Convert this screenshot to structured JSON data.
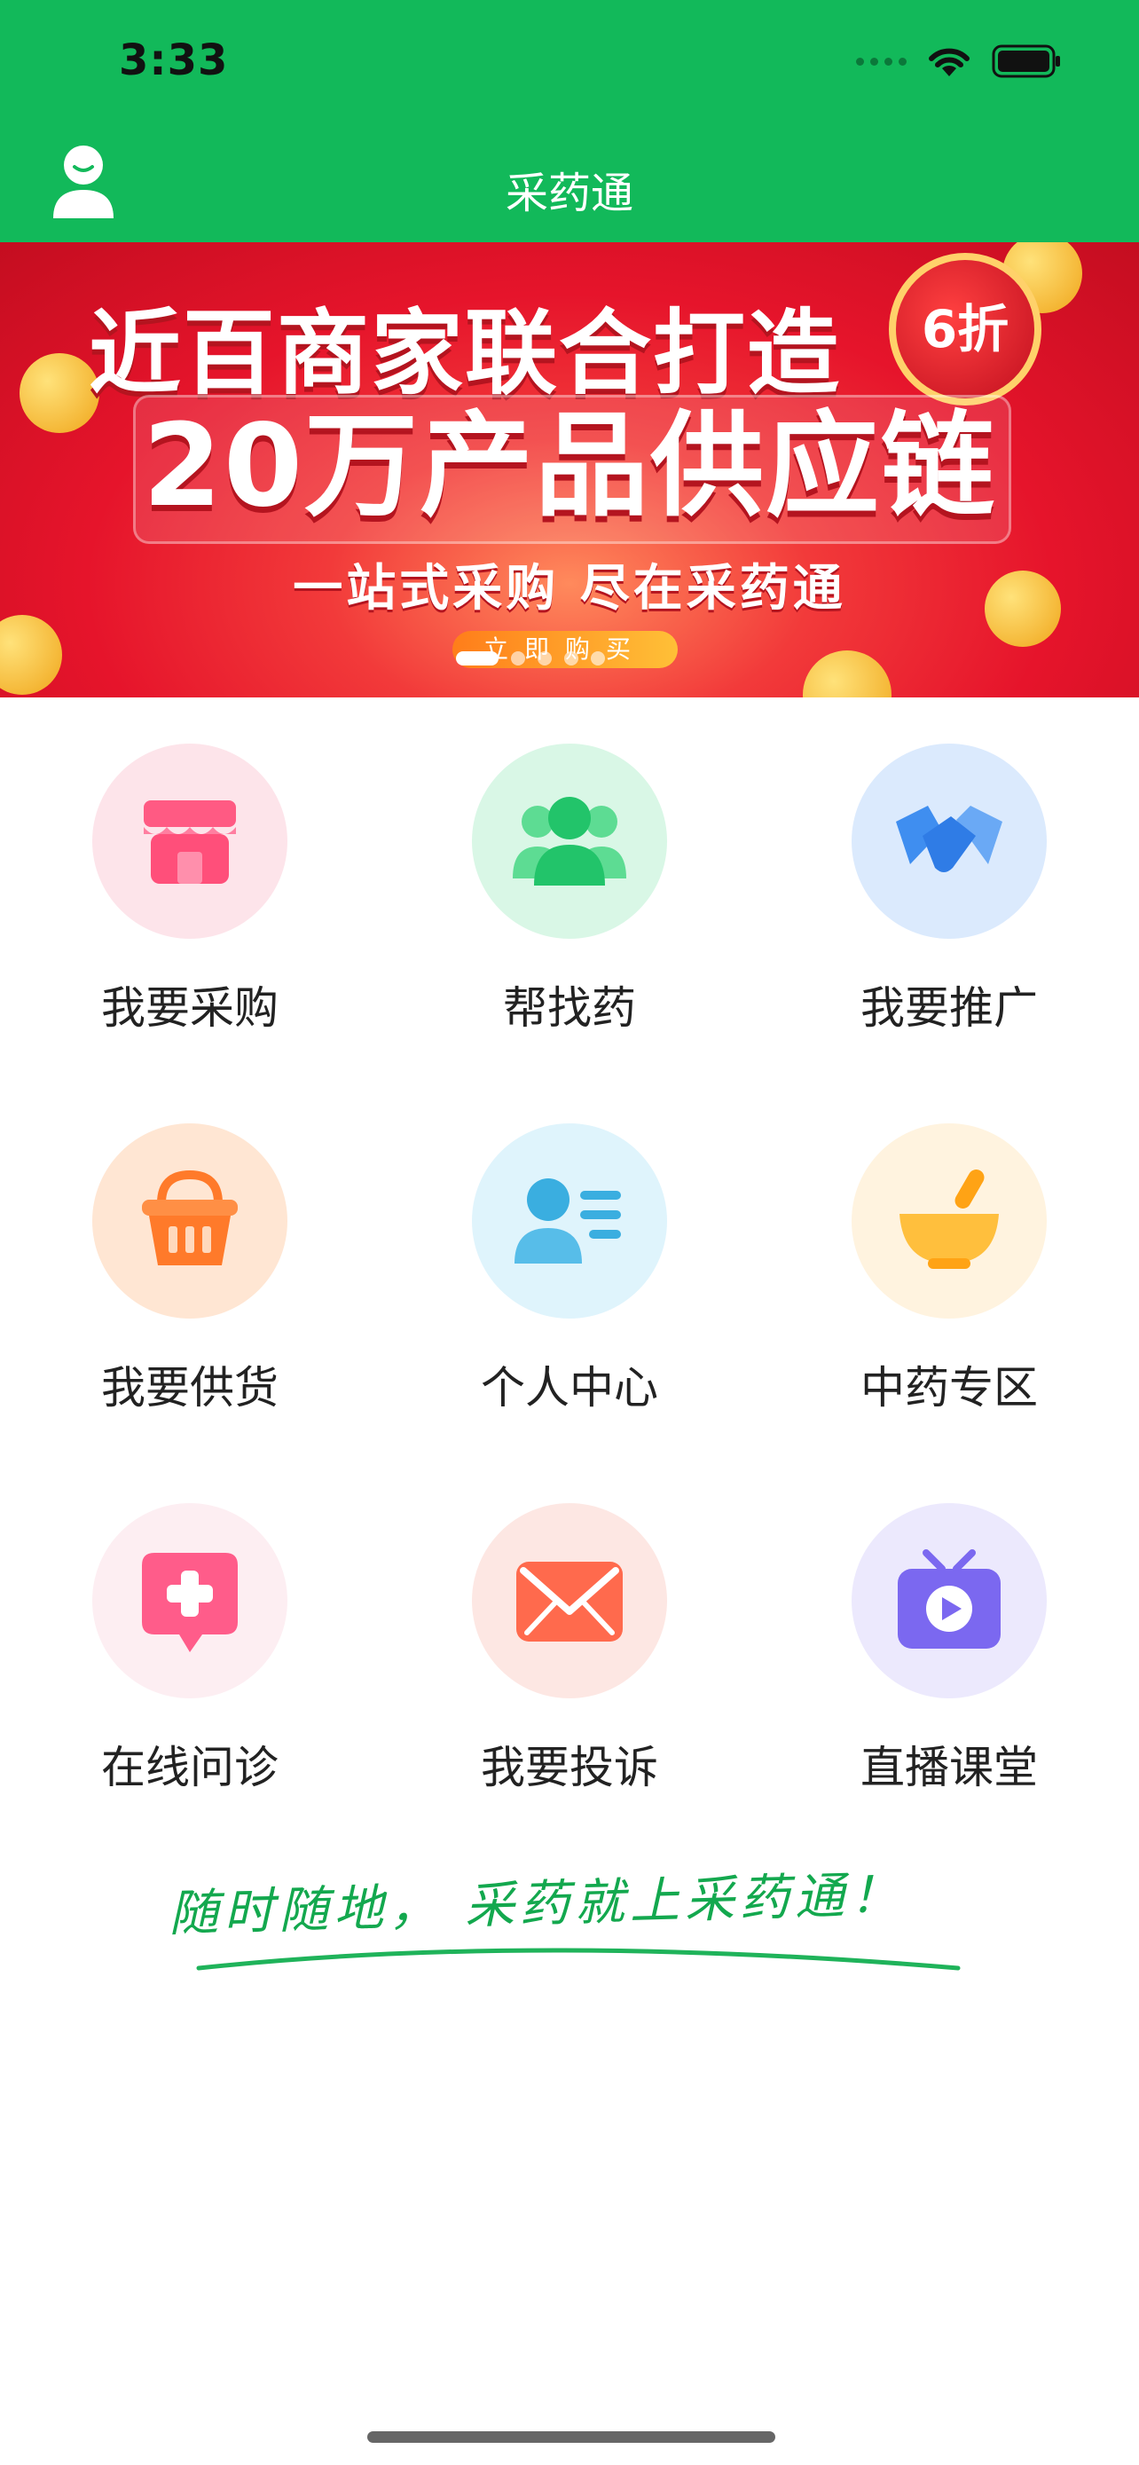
{
  "status_bar": {
    "time": "3:33"
  },
  "header": {
    "title": "采药通"
  },
  "banner": {
    "line1": "近百商家联合打造",
    "line2": "20万产品供应链",
    "line3": "一站式采购 尽在采药通",
    "cta": "立即购买",
    "badge": "6折",
    "page_count": 5,
    "active_page": 1
  },
  "menu": [
    {
      "label": "我要采购",
      "icon": "store-icon",
      "bg": "#fde4ea",
      "color": "#ff4f7a"
    },
    {
      "label": "帮找药",
      "icon": "people-icon",
      "bg": "#d9f7e6",
      "color": "#22c46a"
    },
    {
      "label": "我要推广",
      "icon": "handshake-icon",
      "bg": "#dbeafd",
      "color": "#3f8ef0"
    },
    {
      "label": "我要供货",
      "icon": "basket-icon",
      "bg": "#ffe6d3",
      "color": "#ff7a2a"
    },
    {
      "label": "个人中心",
      "icon": "id-card-icon",
      "bg": "#dff4fc",
      "color": "#3aaee0"
    },
    {
      "label": "中药专区",
      "icon": "mortar-icon",
      "bg": "#fff3df",
      "color": "#ffb52e"
    },
    {
      "label": "在线问诊",
      "icon": "medical-chat-icon",
      "bg": "#fdeef2",
      "color": "#ff5c8a"
    },
    {
      "label": "我要投诉",
      "icon": "envelope-icon",
      "bg": "#fde7e3",
      "color": "#ff6a4d"
    },
    {
      "label": "直播课堂",
      "icon": "tv-play-icon",
      "bg": "#ece9fd",
      "color": "#7b68f0"
    }
  ],
  "slogan": "随时随地， 采药就上采药通！"
}
